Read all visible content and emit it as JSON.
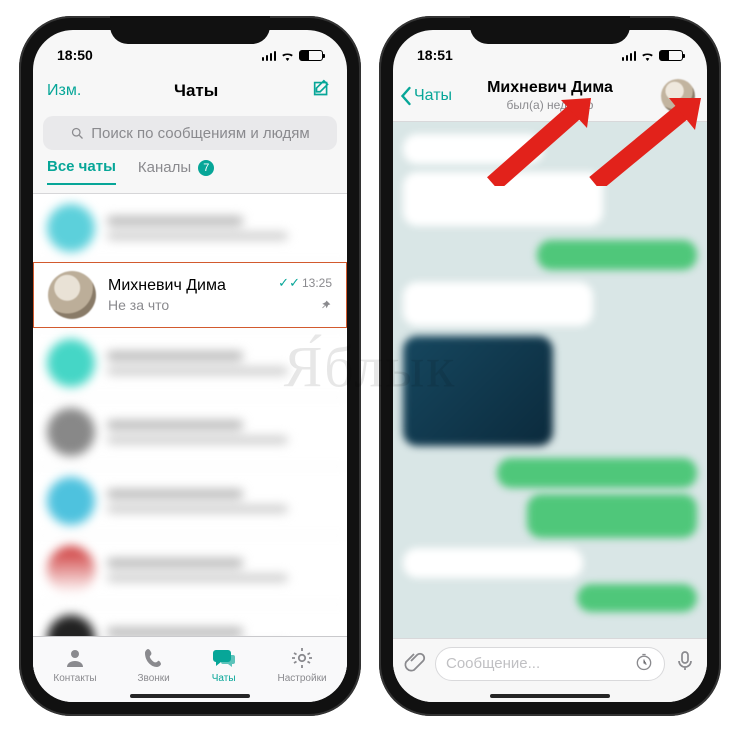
{
  "watermark": "Я́блык",
  "colors": {
    "accent": "#07a698",
    "bubble_out": "#4fc77a",
    "highlight_border": "#d25a2e"
  },
  "left": {
    "status": {
      "time": "18:50"
    },
    "nav": {
      "edit": "Изм.",
      "title": "Чаты"
    },
    "search": {
      "placeholder": "Поиск по сообщениям и людям"
    },
    "tabs": {
      "all": "Все чаты",
      "channels": "Каналы",
      "channels_badge": "7"
    },
    "highlighted_chat": {
      "name": "Михневич Дима",
      "last_message": "Не за что",
      "time": "13:25",
      "read_ticks": "✓✓",
      "pinned": true
    },
    "tabbar": {
      "contacts": "Контакты",
      "calls": "Звонки",
      "chats": "Чаты",
      "settings": "Настройки",
      "active": "chats"
    }
  },
  "right": {
    "status": {
      "time": "18:51"
    },
    "nav": {
      "back_label": "Чаты",
      "title": "Михневич Дима",
      "subtitle": "был(а) недавно"
    },
    "input": {
      "placeholder": "Сообщение..."
    }
  }
}
